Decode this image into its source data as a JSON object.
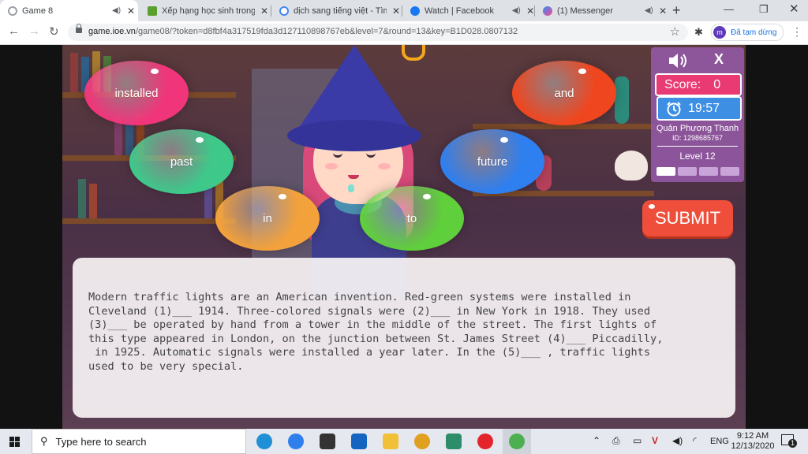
{
  "browser": {
    "tabs": [
      {
        "title": "Game 8",
        "active": true,
        "icon": "loading-icon",
        "color": "#9aa0a6"
      },
      {
        "title": "Xếp hạng học sinh trong trường",
        "active": false,
        "icon": "ioe-icon",
        "color": "#5aa02c"
      },
      {
        "title": "dịch sang tiếng việt - Tìm với Google",
        "active": false,
        "icon": "google-icon",
        "color": "#4285f4"
      },
      {
        "title": "Watch | Facebook",
        "active": false,
        "icon": "facebook-icon",
        "color": "#1877f2"
      },
      {
        "title": "(1) Messenger",
        "active": false,
        "icon": "messenger-icon",
        "color": "#a334fa"
      }
    ],
    "url_host": "game.ioe.vn",
    "url_path": "/game08/?token=d8fbf4a317519fda3d127110898767eb&level=7&round=13&key=B1D028.0807132",
    "profile_initial": "m",
    "profile_label": "Đã tạm dừng"
  },
  "game": {
    "words": [
      {
        "label": "installed",
        "color": "#f0357a"
      },
      {
        "label": "past",
        "color": "#3ec88a"
      },
      {
        "label": "in",
        "color": "#f3a13a"
      },
      {
        "label": "to",
        "color": "#5fcf3b"
      },
      {
        "label": "future",
        "color": "#2e7ff0"
      },
      {
        "label": "and",
        "color": "#f0461f"
      }
    ],
    "panel": {
      "close_label": "X",
      "score_label": "Score:",
      "score_value": "0",
      "timer": "19:57",
      "player_name": "Quản Phương Thanh",
      "player_id": "ID: 1298685767",
      "level": "Level 12",
      "progress_steps": 4,
      "progress_done": 1
    },
    "submit_label": "SUBMIT",
    "passage": "Modern traffic lights are an American invention. Red-green systems were installed in\nCleveland (1)___ 1914. Three-colored signals were (2)___ in New York in 1918. They used\n(3)___ be operated by hand from a tower in the middle of the street. The first lights of\nthis type appeared in London, on the junction between St. James Street (4)___ Piccadilly,\n in 1925. Automatic signals were installed a year later. In the (5)___ , traffic lights\nused to be very special."
  },
  "taskbar": {
    "search_placeholder": "Type here to search",
    "apps": [
      {
        "name": "edge-icon",
        "color": "#1f8fd6"
      },
      {
        "name": "zalo-icon",
        "color": "#2f80ed"
      },
      {
        "name": "store-icon",
        "color": "#333333"
      },
      {
        "name": "mail-icon",
        "color": "#1565c0"
      },
      {
        "name": "explorer-icon",
        "color": "#f2c037"
      },
      {
        "name": "app-icon",
        "color": "#e0a020"
      },
      {
        "name": "vscode-icon",
        "color": "#2d8c6a"
      },
      {
        "name": "opera-icon",
        "color": "#e3242b"
      },
      {
        "name": "chrome-icon",
        "color": "#4caf50"
      }
    ],
    "lang": "ENG",
    "time": "9:12 AM",
    "date": "12/13/2020",
    "notif_count": "1"
  }
}
